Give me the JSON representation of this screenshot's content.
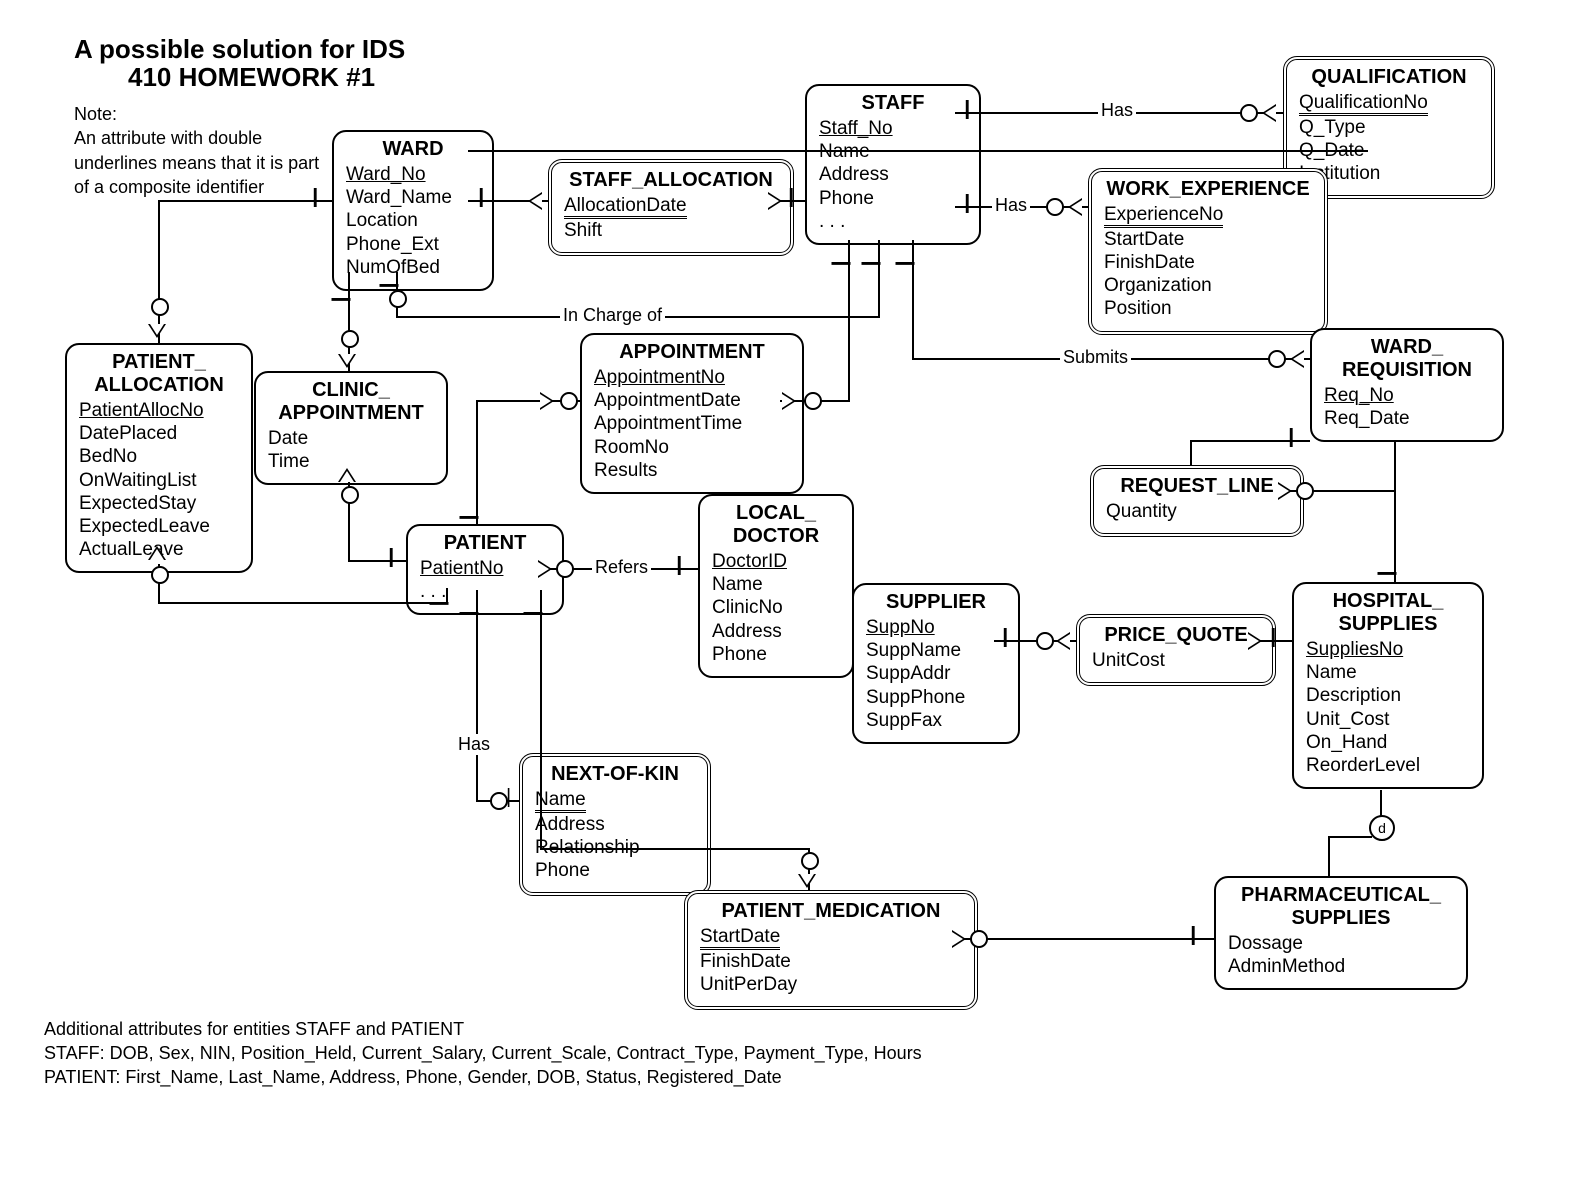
{
  "heading_line1": "A possible solution for IDS",
  "heading_line2": "410 HOMEWORK #1",
  "note": "Note:\nAn attribute with double underlines  means that it is part of a composite identifier",
  "footer_line1": "Additional attributes for entities STAFF and PATIENT",
  "footer_line2": "STAFF: DOB, Sex, NIN, Position_Held, Current_Salary, Current_Scale, Contract_Type, Payment_Type, Hours",
  "footer_line3": "PATIENT: First_Name, Last_Name, Address, Phone, Gender, DOB, Status, Registered_Date",
  "label_in_charge_of": "In Charge of",
  "label_has1": "Has",
  "label_has2": "Has",
  "label_has3": "Has",
  "label_submits": "Submits",
  "label_refers": "Refers",
  "label_d": "d",
  "entities": {
    "ward": {
      "title": "WARD",
      "attrs": [
        {
          "t": "Ward_No",
          "k": "pk"
        },
        {
          "t": "Ward_Name"
        },
        {
          "t": "Location"
        },
        {
          "t": "Phone_Ext"
        },
        {
          "t": "NumOfBed"
        }
      ]
    },
    "staff_allocation": {
      "title": "STAFF_ALLOCATION",
      "attrs": [
        {
          "t": "AllocationDate",
          "k": "pk2"
        },
        {
          "t": "Shift"
        }
      ]
    },
    "staff": {
      "title": "STAFF",
      "attrs": [
        {
          "t": "Staff_No",
          "k": "pk"
        },
        {
          "t": "Name"
        },
        {
          "t": "Address"
        },
        {
          "t": "Phone"
        },
        {
          "t": ". . ."
        }
      ]
    },
    "qualification": {
      "title": "QUALIFICATION",
      "attrs": [
        {
          "t": "QualificationNo",
          "k": "pk2"
        },
        {
          "t": "Q_Type"
        },
        {
          "t": "Q_Date"
        },
        {
          "t": "Institution"
        }
      ]
    },
    "work_experience": {
      "title": "WORK_EXPERIENCE",
      "attrs": [
        {
          "t": "ExperienceNo",
          "k": "pk2"
        },
        {
          "t": "StartDate"
        },
        {
          "t": "FinishDate"
        },
        {
          "t": "Organization"
        },
        {
          "t": "Position"
        }
      ]
    },
    "patient_allocation": {
      "title": "PATIENT_\nALLOCATION",
      "attrs": [
        {
          "t": "PatientAllocNo",
          "k": "pk"
        },
        {
          "t": "DatePlaced"
        },
        {
          "t": "BedNo"
        },
        {
          "t": "OnWaitingList"
        },
        {
          "t": "ExpectedStay"
        },
        {
          "t": "ExpectedLeave"
        },
        {
          "t": "ActualLeave"
        }
      ]
    },
    "clinic_appointment": {
      "title": "CLINIC_\nAPPOINTMENT",
      "attrs": [
        {
          "t": "Date"
        },
        {
          "t": "Time"
        }
      ]
    },
    "appointment": {
      "title": "APPOINTMENT",
      "attrs": [
        {
          "t": "AppointmentNo",
          "k": "pk"
        },
        {
          "t": "AppointmentDate"
        },
        {
          "t": "AppointmentTime"
        },
        {
          "t": "RoomNo"
        },
        {
          "t": "Results"
        }
      ]
    },
    "patient": {
      "title": "PATIENT",
      "attrs": [
        {
          "t": "PatientNo",
          "k": "pk"
        },
        {
          "t": ". . ."
        }
      ]
    },
    "local_doctor": {
      "title": "LOCAL_\nDOCTOR",
      "attrs": [
        {
          "t": "DoctorID",
          "k": "pk"
        },
        {
          "t": "Name"
        },
        {
          "t": "ClinicNo"
        },
        {
          "t": "Address"
        },
        {
          "t": "Phone"
        }
      ]
    },
    "next_of_kin": {
      "title": "NEXT-OF-KIN",
      "attrs": [
        {
          "t": "Name",
          "k": "pk2"
        },
        {
          "t": "Address"
        },
        {
          "t": "Relationship"
        },
        {
          "t": "Phone"
        }
      ]
    },
    "supplier": {
      "title": "SUPPLIER",
      "attrs": [
        {
          "t": "SuppNo",
          "k": "pk"
        },
        {
          "t": "SuppName"
        },
        {
          "t": "SuppAddr"
        },
        {
          "t": "SuppPhone"
        },
        {
          "t": "SuppFax"
        }
      ]
    },
    "price_quote": {
      "title": "PRICE_QUOTE",
      "attrs": [
        {
          "t": "UnitCost"
        }
      ]
    },
    "ward_requisition": {
      "title": "WARD_\nREQUISITION",
      "attrs": [
        {
          "t": "Req_No",
          "k": "pk"
        },
        {
          "t": "Req_Date"
        }
      ]
    },
    "request_line": {
      "title": "REQUEST_LINE",
      "attrs": [
        {
          "t": "Quantity"
        }
      ]
    },
    "hospital_supplies": {
      "title": "HOSPITAL_\nSUPPLIES",
      "attrs": [
        {
          "t": "SuppliesNo",
          "k": "pk"
        },
        {
          "t": "Name"
        },
        {
          "t": "Description"
        },
        {
          "t": "Unit_Cost"
        },
        {
          "t": "On_Hand"
        },
        {
          "t": "ReorderLevel"
        }
      ]
    },
    "patient_medication": {
      "title": "PATIENT_MEDICATION",
      "attrs": [
        {
          "t": "StartDate",
          "k": "pk2"
        },
        {
          "t": "FinishDate"
        },
        {
          "t": "UnitPerDay"
        }
      ]
    },
    "pharmaceutical_supplies": {
      "title": "PHARMACEUTICAL_\nSUPPLIES",
      "attrs": [
        {
          "t": "Dossage"
        },
        {
          "t": "AdminMethod"
        }
      ]
    }
  }
}
